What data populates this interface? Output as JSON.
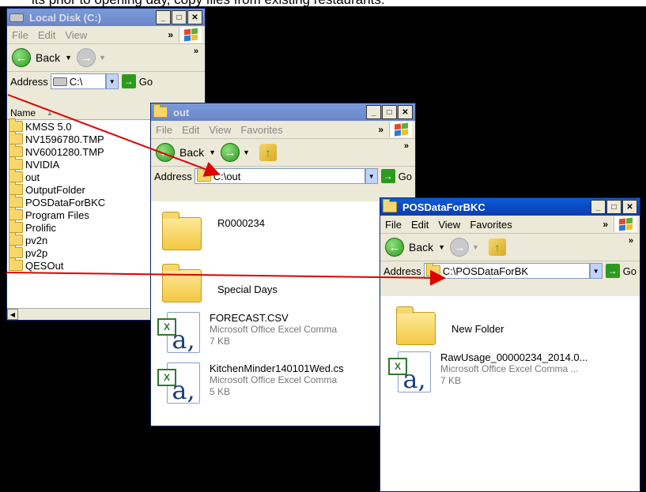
{
  "top_text": "its prior to opening day, copy files from existing restaurants.",
  "window_local": {
    "title": "Local Disk (C:)",
    "menu": [
      "File",
      "Edit",
      "View"
    ],
    "menu_more": "»",
    "back_label": "Back",
    "toolbar_more": "»",
    "address_label": "Address",
    "address_value": "C:\\",
    "go_label": "Go",
    "column_header": "Name",
    "items": [
      "KMSS 5.0",
      "NV1596780.TMP",
      "NV6001280.TMP",
      "NVIDIA",
      "out",
      "OutputFolder",
      "POSDataForBKC",
      "Program Files",
      "Prolific",
      "pv2n",
      "pv2p",
      "QESOut"
    ],
    "selected_item": "out"
  },
  "window_out": {
    "title": "out",
    "menu": [
      "File",
      "Edit",
      "View",
      "Favorites"
    ],
    "menu_more": "»",
    "back_label": "Back",
    "toolbar_more": "»",
    "address_label": "Address",
    "address_value": "C:\\out",
    "go_label": "Go",
    "folders": [
      "R0000234",
      "Special Days"
    ],
    "files": [
      {
        "name": "FORECAST.CSV",
        "type": "Microsoft Office Excel Comma",
        "size": "7 KB"
      },
      {
        "name": "KitchenMinder140101Wed.cs",
        "type": "Microsoft Office Excel Comma",
        "size": "5 KB"
      }
    ]
  },
  "window_pos": {
    "title": "POSDataForBKC",
    "menu": [
      "File",
      "Edit",
      "View",
      "Favorites"
    ],
    "menu_more": "»",
    "back_label": "Back",
    "toolbar_more": "»",
    "address_label": "Address",
    "address_value": "C:\\POSDataForBK",
    "go_label": "Go",
    "folders": [
      "New Folder"
    ],
    "files": [
      {
        "name": "RawUsage_00000234_2014.0...",
        "type": "Microsoft Office Excel Comma ...",
        "size": "7 KB"
      }
    ]
  },
  "colors": {
    "arrow": "#e00000",
    "title_active": "#0a4bc4",
    "title_inactive": "#7b9bd8"
  },
  "icons": [
    "drive-icon",
    "folder-icon",
    "back-arrow-icon",
    "forward-arrow-icon",
    "up-folder-icon",
    "go-arrow-icon",
    "windows-logo-icon",
    "excel-file-icon"
  ]
}
